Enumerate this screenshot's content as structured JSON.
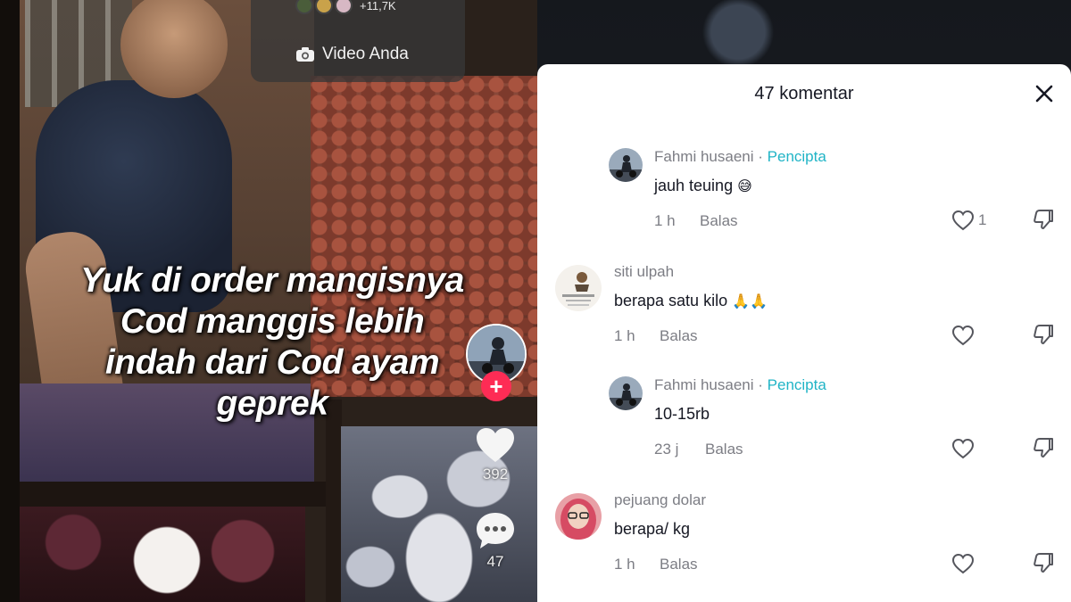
{
  "video": {
    "reply_count": "+11,7K",
    "your_video_label": "Video Anda",
    "caption_lines": [
      "Yuk di order mangisnya",
      "Cod manggis lebih",
      "indah dari Cod ayam",
      "geprek"
    ],
    "like_count": "392",
    "comment_count": "47",
    "follow_symbol": "+"
  },
  "comments_panel": {
    "title": "47 komentar",
    "comments": [
      {
        "username": "Fahmi husaeni",
        "creator_tag": "Pencipta",
        "text": "jauh teuing",
        "emoji": "😅",
        "time": "1 h",
        "reply_label": "Balas",
        "likes": "1",
        "avatar_icon": "motorbike-avatar-icon"
      },
      {
        "username": "siti ulpah",
        "creator_tag": "",
        "text": "berapa satu kilo",
        "emoji": "🙏🙏",
        "time": "1 h",
        "reply_label": "Balas",
        "likes": "",
        "avatar_icon": "profile-photo-icon"
      },
      {
        "username": "Fahmi husaeni",
        "creator_tag": "Pencipta",
        "text": "10-15rb",
        "emoji": "",
        "time": "23 j",
        "reply_label": "Balas",
        "likes": "",
        "avatar_icon": "motorbike-avatar-icon"
      },
      {
        "username": "pejuang dolar",
        "creator_tag": "",
        "text": "berapa/ kg",
        "emoji": "",
        "time": "1 h",
        "reply_label": "Balas",
        "likes": "",
        "avatar_icon": "hijab-profile-avatar-icon"
      }
    ]
  },
  "colors": {
    "creator_accent": "#20b4c6",
    "follow_button": "#fe2c55",
    "muted_text": "#7c7d84",
    "primary_text": "#161823"
  }
}
